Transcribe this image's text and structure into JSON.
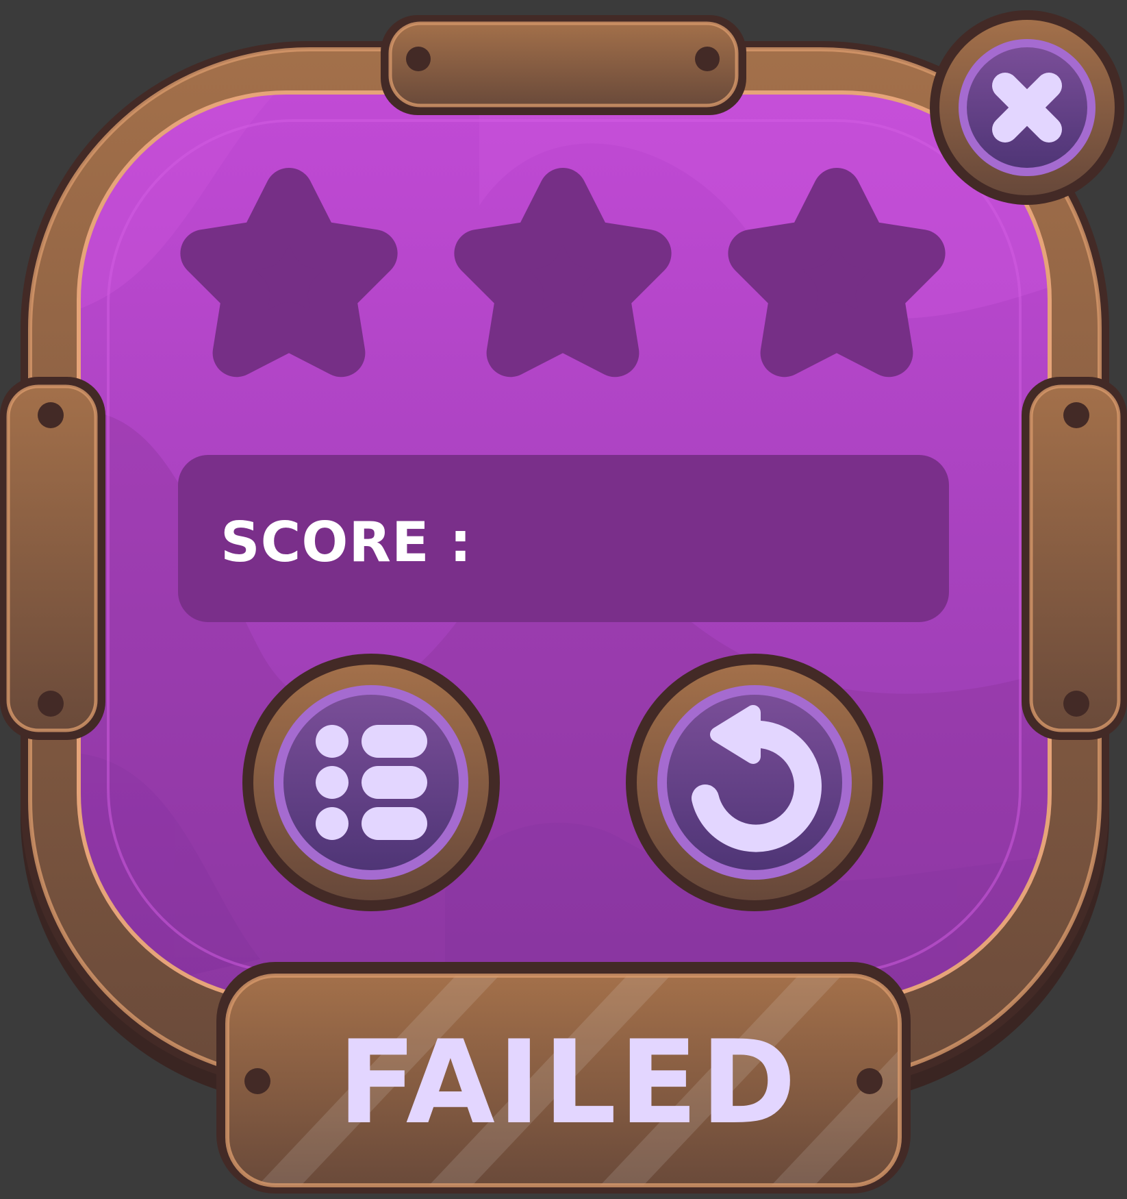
{
  "dialog": {
    "result_text": "FAILED",
    "score_label": "SCORE :",
    "score_value": ""
  },
  "stars": {
    "total": 3,
    "earned": 0
  },
  "buttons": {
    "close_icon": "close-icon",
    "menu_icon": "level-list-icon",
    "retry_icon": "restart-icon"
  },
  "colors": {
    "background": "#3b3b3b",
    "wood": "#9a6a44",
    "panel": "#b347c9",
    "star_empty": "#762f86",
    "score_box": "#7a2f8a",
    "button_face": "#5f3e85",
    "icon": "#e3d6ff",
    "outline": "#432a26"
  }
}
